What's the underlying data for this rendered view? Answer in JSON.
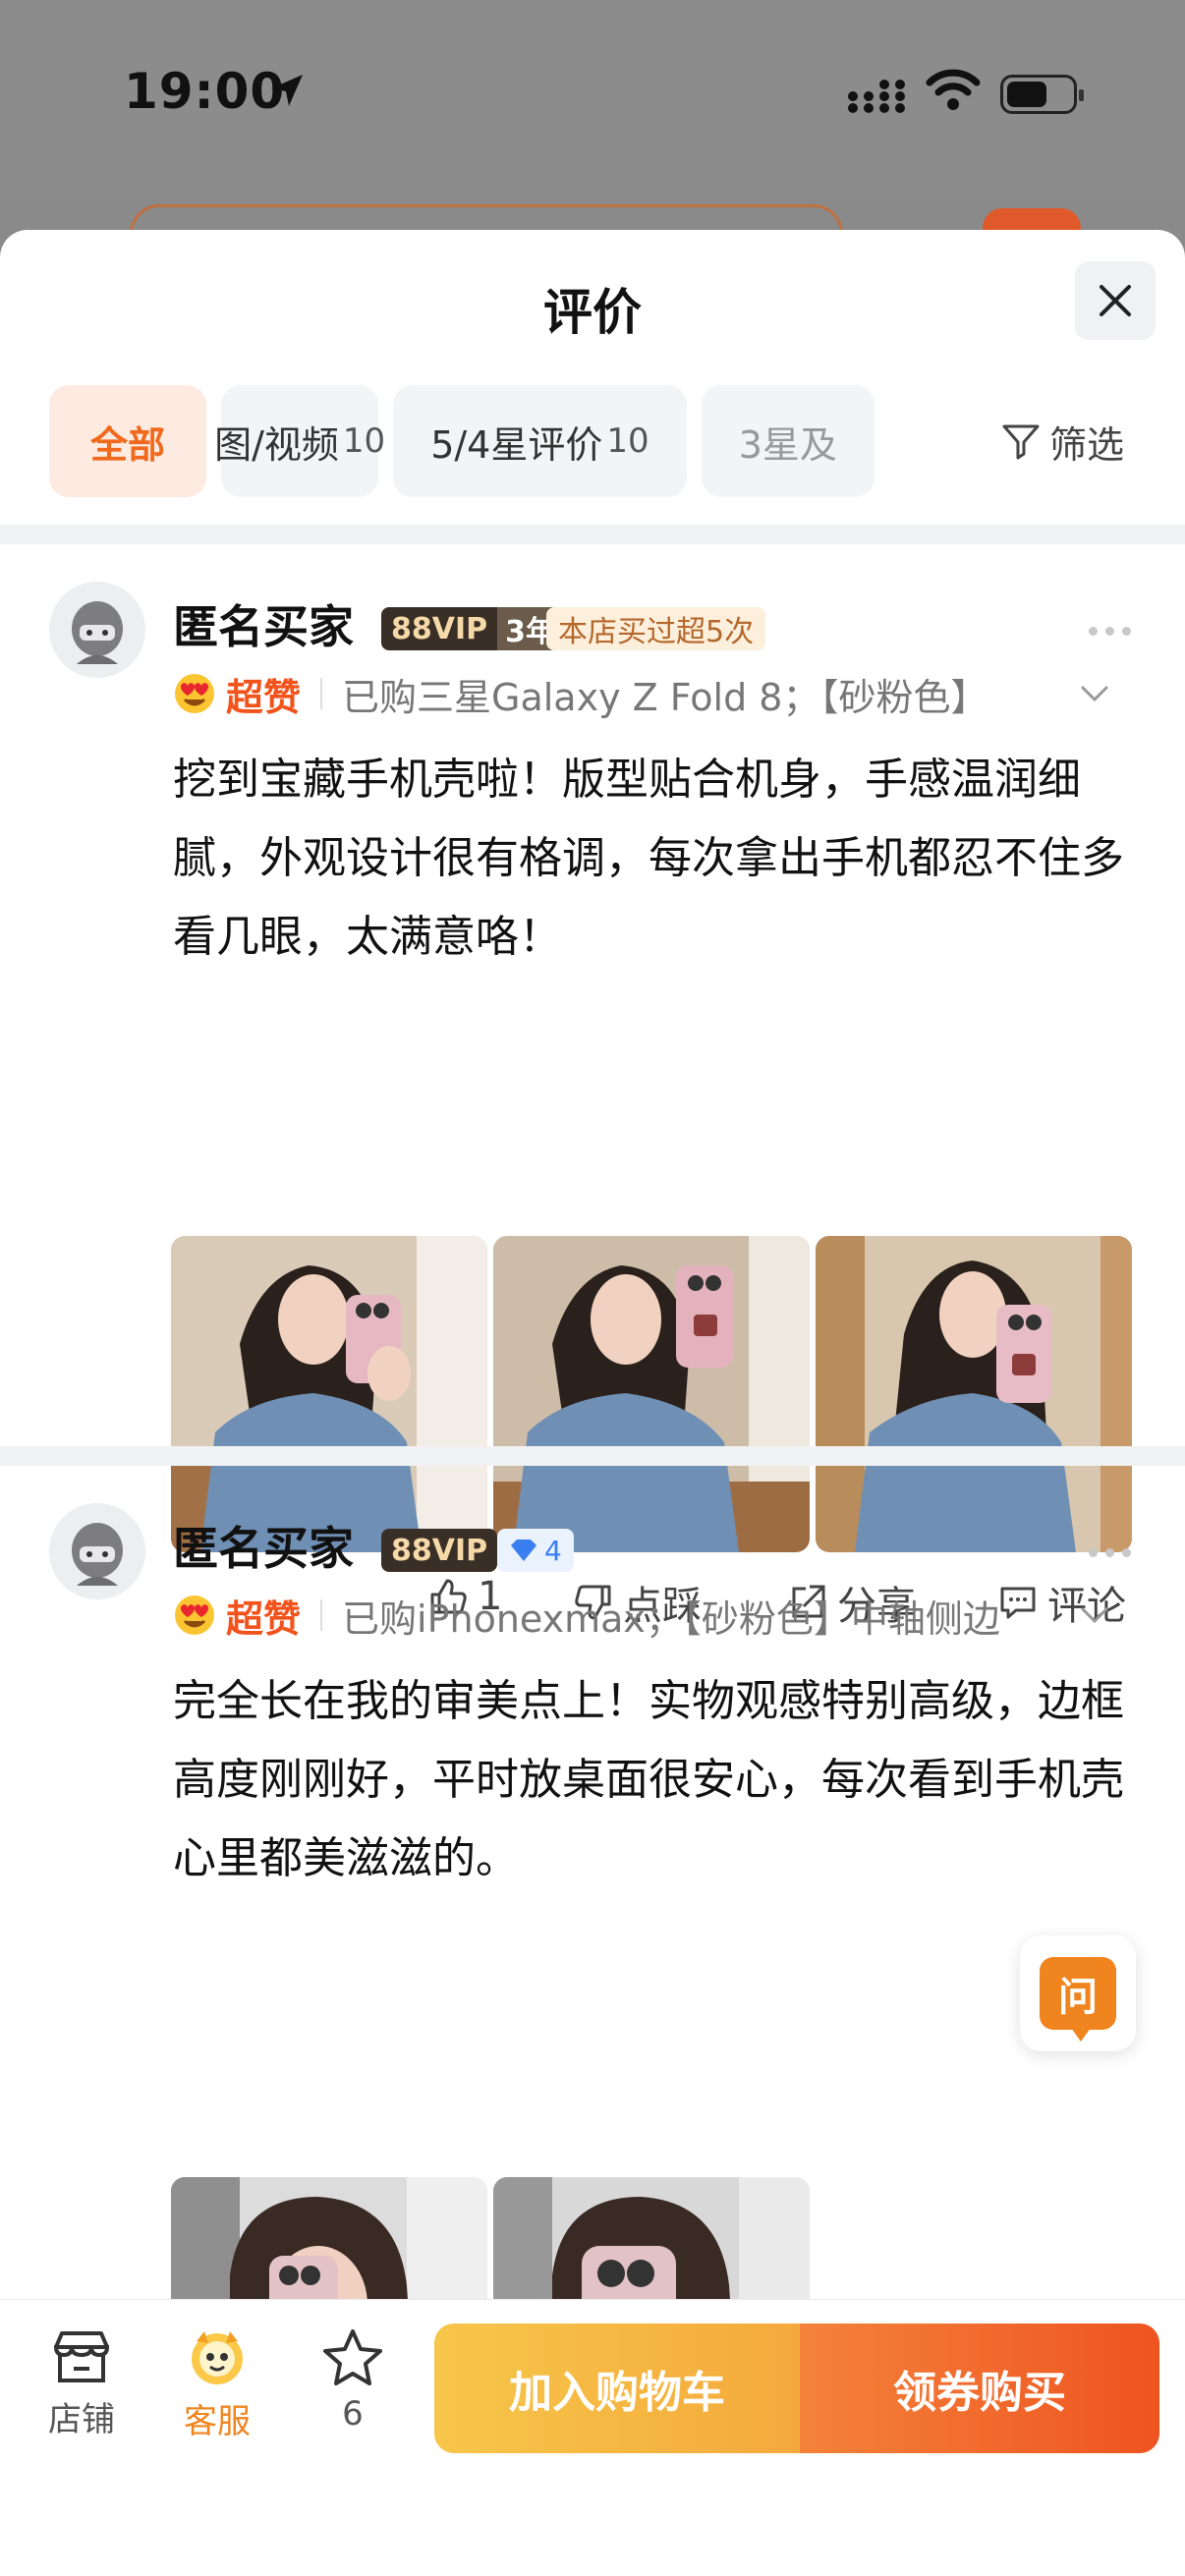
{
  "status_bar": {
    "time": "19:00"
  },
  "sheet": {
    "title": "评价"
  },
  "tabs": [
    {
      "label": "全部",
      "count": ""
    },
    {
      "label": "图/视频",
      "count": "10"
    },
    {
      "label": "5/4星评价",
      "count": "10"
    },
    {
      "label": "3星及",
      "count": ""
    }
  ],
  "filter_label": "筛选",
  "reviews": [
    {
      "user": "匿名买家",
      "vip": "88VIP",
      "vip_years": "3年",
      "tag": "本店买过超5次",
      "rating_label": "超赞",
      "purchase": "已购三星Galaxy Z Fold 8；【砂粉色】",
      "text": "挖到宝藏手机壳啦！版型贴合机身，手感温润细腻，外观设计很有格调，每次拿出手机都忍不住多看几眼，太满意咯！",
      "likes": "1",
      "dislike_label": "点踩",
      "share_label": "分享",
      "comment_label": "评论"
    },
    {
      "user": "匿名买家",
      "vip": "88VIP",
      "gem_level": "4",
      "rating_label": "超赞",
      "purchase": "已购iPhonexmax；【砂粉色】中轴侧边",
      "text": "完全长在我的审美点上！实物观感特别高级，边框高度刚刚好，平时放桌面很安心，每次看到手机壳心里都美滋滋的。",
      "likes_label": "点赞",
      "dislike_label": "点踩",
      "share_label": "分享",
      "comment_label": "评论"
    }
  ],
  "ask_label": "问",
  "bottom_bar": {
    "shop": "店铺",
    "service": "客服",
    "fav_count": "6",
    "add_cart": "加入购物车",
    "buy": "领券购买"
  }
}
